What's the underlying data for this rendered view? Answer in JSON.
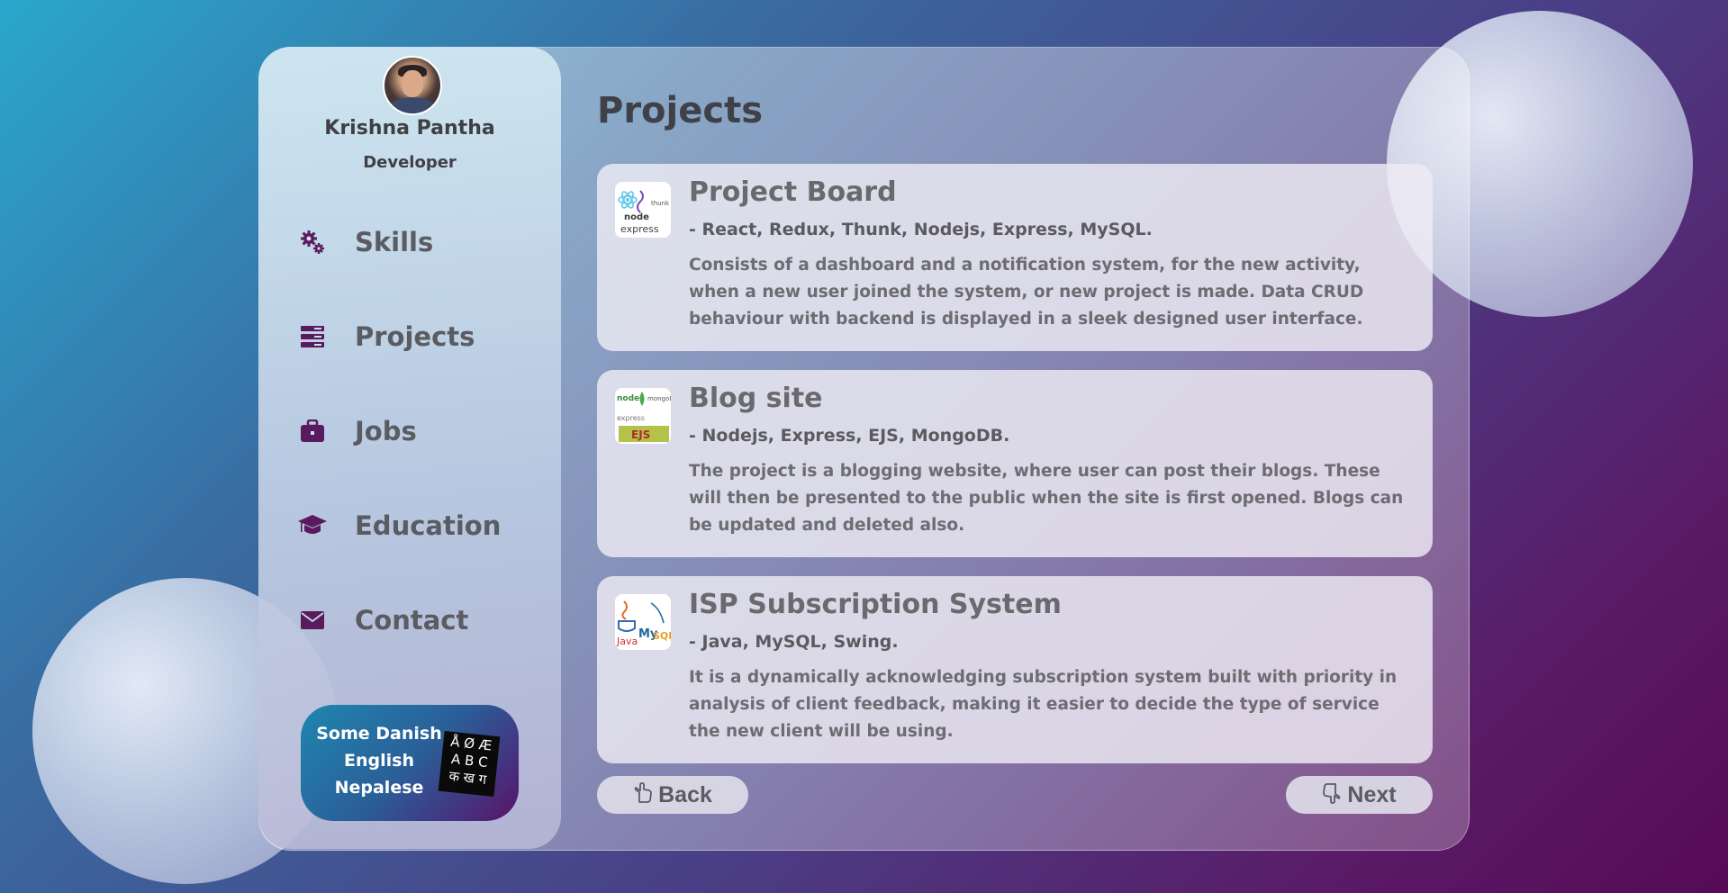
{
  "profile": {
    "name": "Krishna Pantha",
    "role": "Developer"
  },
  "sidebar": {
    "items": [
      {
        "label": "Skills",
        "icon": "gears-icon"
      },
      {
        "label": "Projects",
        "icon": "server-icon"
      },
      {
        "label": "Jobs",
        "icon": "briefcase-icon"
      },
      {
        "label": "Education",
        "icon": "graduation-cap-icon"
      },
      {
        "label": "Contact",
        "icon": "envelope-icon"
      }
    ],
    "language_button": {
      "line1": "Some Danish",
      "line2": "English",
      "line3": "Nepalese",
      "glyph_row1": "Å Ø Æ",
      "glyph_row2": "A B C",
      "glyph_row3": "क ख ग"
    }
  },
  "main": {
    "title": "Projects",
    "projects": [
      {
        "title": "Project Board",
        "tech": "- React, Redux, Thunk, Nodejs, Express, MySQL.",
        "description": "Consists of a dashboard and a notification system, for the new activity, when a new user joined the system, or new project is made. Data CRUD behaviour with backend is displayed in a sleek designed user interface.",
        "thumb_text": "express"
      },
      {
        "title": "Blog site",
        "tech": "- Nodejs, Express, EJS, MongoDB.",
        "description": "The project is a blogging website, where user can post their blogs. These will then be presented to the public when the site is first opened. Blogs can be updated and deleted also.",
        "thumb_text": "EJS"
      },
      {
        "title": "ISP Subscription System",
        "tech": "- Java, MySQL, Swing.",
        "description": "It is a dynamically acknowledging subscription system built with priority in analysis of client feedback, making it easier to decide the type of service the new client will be using.",
        "thumb_text": "Java"
      }
    ],
    "pager": {
      "back": "Back",
      "next": "Next"
    }
  },
  "colors": {
    "icon": "#5a1a5e",
    "text": "#5b5b62",
    "heading": "#3f4048"
  }
}
